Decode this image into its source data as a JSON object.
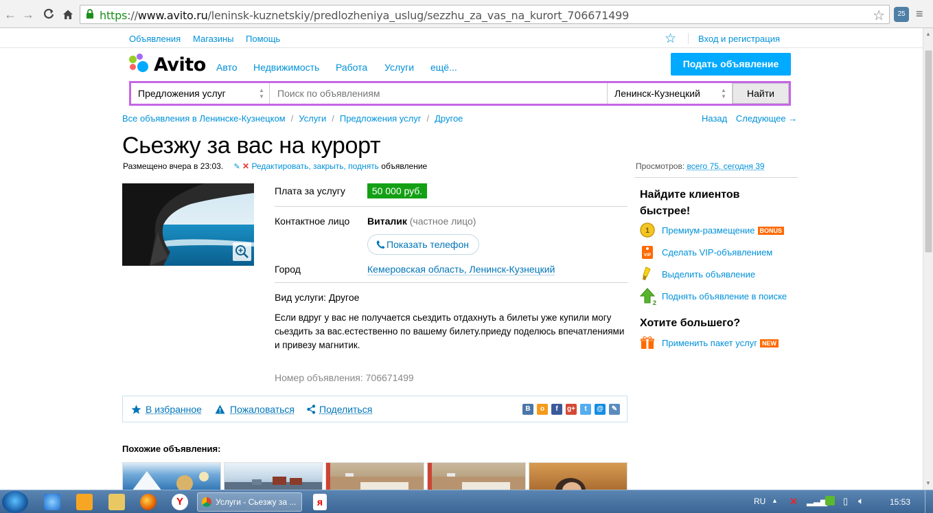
{
  "browser": {
    "url_scheme": "https",
    "url_sep": "://",
    "url_domain": "www.avito.ru",
    "url_path": "/leninsk-kuznetskiy/predlozheniya_uslug/sezzhu_za_vas_na_kurort_706671499",
    "ext_badge": "25"
  },
  "topbar": {
    "ads": "Объявления",
    "shops": "Магазины",
    "help": "Помощь",
    "login": "Вход и регистрация"
  },
  "logo": {
    "text": "Avito"
  },
  "nav": [
    "Авто",
    "Недвижимость",
    "Работа",
    "Услуги",
    "ещё..."
  ],
  "post_button": "Подать объявление",
  "search": {
    "category": "Предложения услуг",
    "placeholder": "Поиск по объявлениям",
    "city": "Ленинск-Кузнецкий",
    "button": "Найти"
  },
  "breadcrumbs": [
    "Все объявления в Ленинске-Кузнецком",
    "Услуги",
    "Предложения услуг",
    "Другое"
  ],
  "pager": {
    "back": "Назад",
    "next": "Следующее →"
  },
  "ad": {
    "title": "Сьезжу за вас на курорт",
    "posted": "Размещено вчера в 23:03.",
    "edit_link": "Редактировать, закрыть, поднять",
    "edit_suffix": "объявление",
    "views_label": "Просмотров:",
    "views_value": "всего 75, сегодня 39",
    "price_label": "Плата за услугу",
    "price": "50 000 руб.",
    "contact_label": "Контактное лицо",
    "contact_name": "Виталик",
    "contact_type": "(частное лицо)",
    "phone_button": "Показать телефон",
    "city_label": "Город",
    "city_value": "Кемеровская область, Ленинск-Кузнецкий",
    "service_type": "Вид услуги: Другое",
    "description": "Если вдруг у вас не получается сьездить отдахнуть а билеты уже купили могу сьездить за вас.естественно по вашему билету.приеду поделюсь впечатлениями и привезу магнитик.",
    "ad_number": "Номер объявления: 706671499"
  },
  "actions": {
    "favorite": "В избранное",
    "report": "Пожаловаться",
    "share": "Поделиться",
    "social": [
      {
        "name": "vk-icon",
        "glyph": "В",
        "color": "#4a76a8"
      },
      {
        "name": "odnoklassniki-icon",
        "glyph": "о",
        "color": "#f59a1b"
      },
      {
        "name": "facebook-icon",
        "glyph": "f",
        "color": "#3b5998"
      },
      {
        "name": "googleplus-icon",
        "glyph": "g+",
        "color": "#d34836"
      },
      {
        "name": "twitter-icon",
        "glyph": "t",
        "color": "#55acee"
      },
      {
        "name": "mailru-icon",
        "glyph": "@",
        "color": "#168de2"
      },
      {
        "name": "livejournal-icon",
        "glyph": "✎",
        "color": "#5a8bbd"
      }
    ]
  },
  "similar": {
    "title": "Похожие объявления:"
  },
  "sidebar": {
    "heading1": "Найдите клиентов быстрее!",
    "premium": "Премиум-размещение",
    "premium_badge": "BONUS",
    "vip": "Сделать VIP-объявлением",
    "highlight": "Выделить объявление",
    "raise": "Поднять объявление в поиске",
    "heading2": "Хотите большего?",
    "package": "Применить пакет услуг",
    "package_badge": "NEW"
  },
  "taskbar": {
    "task_title": "Услуги - Сьезжу за ...",
    "lang": "RU",
    "time": "15:53"
  },
  "colors": {
    "link": "#0091d9",
    "accent_button": "#00aaff",
    "search_border": "#c566e6",
    "price_bg": "#14a014",
    "badge": "#ff6a00"
  }
}
